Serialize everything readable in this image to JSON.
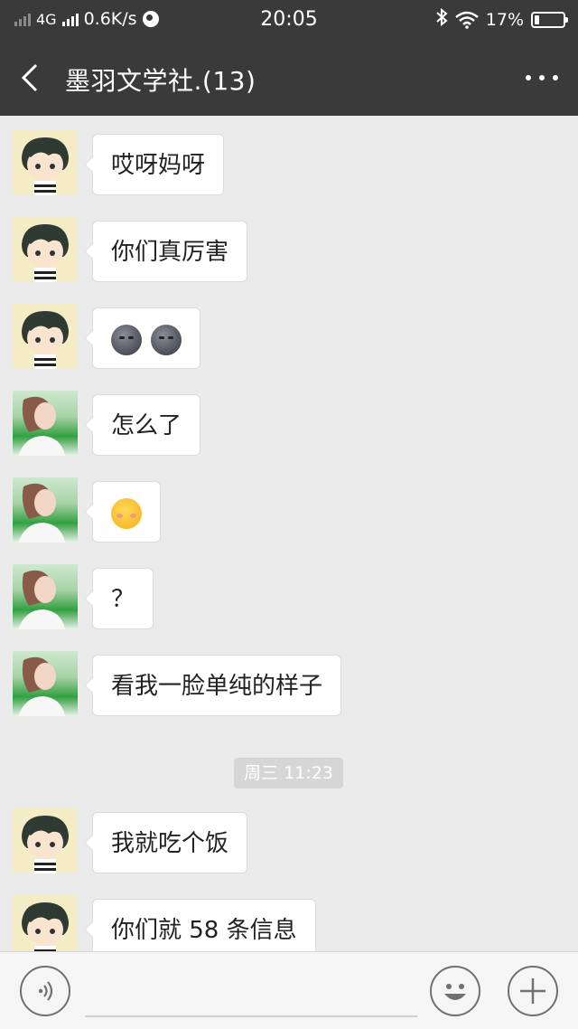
{
  "status_bar": {
    "network": "4G",
    "speed": "0.6K/s",
    "time": "20:05",
    "battery": "17%",
    "battery_level": 0.17,
    "icons": [
      "signal-icon",
      "globe-icon",
      "bluetooth-icon",
      "wifi-icon",
      "battery-icon"
    ]
  },
  "header": {
    "title": "墨羽文学社.(13)",
    "icons": [
      "back-arrow-icon",
      "more-dots-icon"
    ]
  },
  "messages": [
    {
      "sender": "boy",
      "text": "哎呀妈呀"
    },
    {
      "sender": "boy",
      "text": "你们真厉害"
    },
    {
      "sender": "boy",
      "emoji": [
        "new-moon-face",
        "new-moon-face"
      ]
    },
    {
      "sender": "girl",
      "text": "怎么了"
    },
    {
      "sender": "girl",
      "emoji": [
        "blushing-face"
      ]
    },
    {
      "sender": "girl",
      "text": "？"
    },
    {
      "sender": "girl",
      "text": "看我一脸单纯的样子"
    },
    {
      "sender": "boy",
      "text": "我就吃个饭"
    },
    {
      "sender": "boy",
      "text": "你们就 58 条信息"
    }
  ],
  "divider": "周三 11:23",
  "input_bar": {
    "icons": [
      "voice-icon",
      "emoji-icon",
      "plus-icon"
    ]
  }
}
